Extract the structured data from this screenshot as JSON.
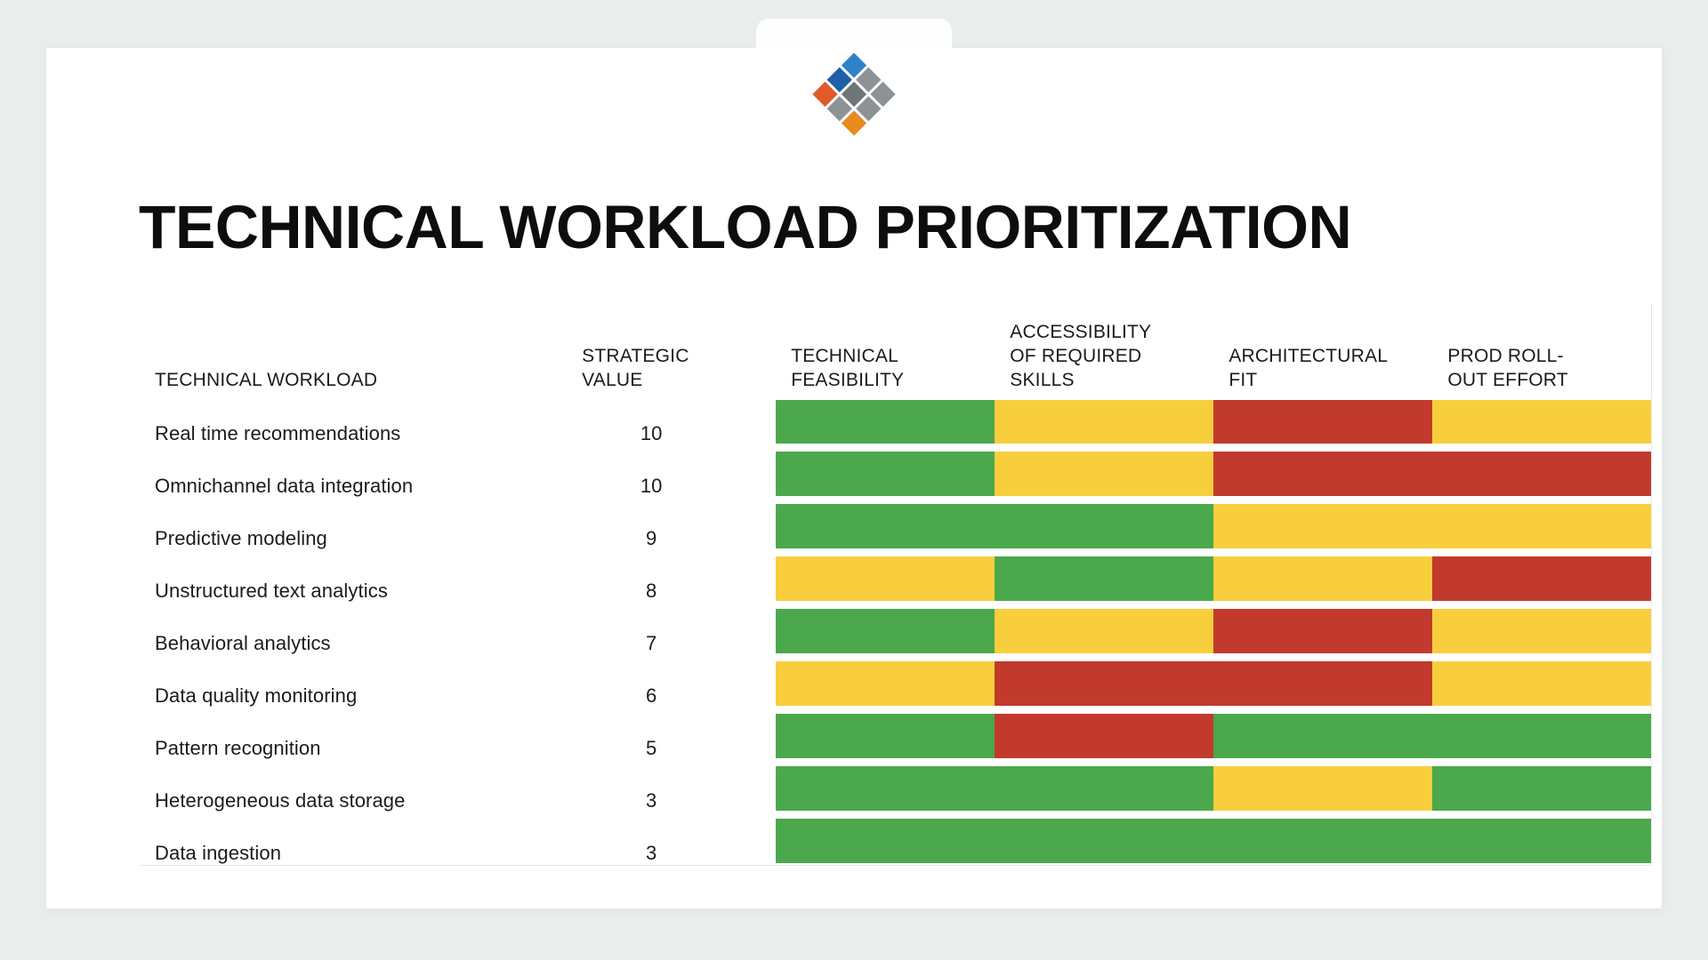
{
  "slide": {
    "title": "TECHNICAL WORKLOAD PRIORITIZATION",
    "background_color": "#e9edec",
    "card_color": "#ffffff"
  },
  "logo": {
    "name": "diamond-grid-logo",
    "tiles": [
      {
        "position": "top-left",
        "color": "#2e83c6"
      },
      {
        "position": "top-center",
        "color": "#8d9296"
      },
      {
        "position": "top-right",
        "color": "#8d9296"
      },
      {
        "position": "middle-left",
        "color": "#1f5fa9"
      },
      {
        "position": "middle-center",
        "color": "#6f7477"
      },
      {
        "position": "middle-right",
        "color": "#8d9296"
      },
      {
        "position": "bottom-left",
        "color": "#8d9296"
      },
      {
        "position": "bottom-center",
        "color": "#8d9296"
      },
      {
        "position": "bottom-right",
        "color": "#e98a1f"
      }
    ],
    "accent_bottom": "#e05a2b"
  },
  "legend_colors": {
    "green": "#4ba84c",
    "yellow": "#f8ce3d",
    "red": "#c13a2d"
  },
  "table": {
    "headers": {
      "workload": "TECHNICAL WORKLOAD",
      "strategic_value": "STRATEGIC\nVALUE",
      "spacer": "",
      "technical_feasibility": "TECHNICAL\nFEASIBILITY",
      "accessibility": "ACCESSIBILITY\nOF REQUIRED\nSKILLS",
      "architectural_fit": "ARCHITECTURAL\nFIT",
      "prod_rollout": "PROD ROLL-\nOUT EFFORT"
    },
    "header_list": [
      "TECHNICAL WORKLOAD",
      "STRATEGIC VALUE",
      "",
      "TECHNICAL FEASIBILITY",
      "ACCESSIBILITY OF REQUIRED SKILLS",
      "ARCHITECTURAL FIT",
      "PROD ROLL-OUT EFFORT"
    ],
    "rows": [
      {
        "workload": "Real time recommendations",
        "strategic_value": "10",
        "technical_feasibility": "green",
        "accessibility": "yellow",
        "architectural_fit": "red",
        "prod_rollout": "yellow"
      },
      {
        "workload": "Omnichannel data integration",
        "strategic_value": "10",
        "technical_feasibility": "green",
        "accessibility": "yellow",
        "architectural_fit": "red",
        "prod_rollout": "red"
      },
      {
        "workload": "Predictive modeling",
        "strategic_value": "9",
        "technical_feasibility": "green",
        "accessibility": "green",
        "architectural_fit": "yellow",
        "prod_rollout": "yellow"
      },
      {
        "workload": "Unstructured text analytics",
        "strategic_value": "8",
        "technical_feasibility": "yellow",
        "accessibility": "green",
        "architectural_fit": "yellow",
        "prod_rollout": "red"
      },
      {
        "workload": "Behavioral analytics",
        "strategic_value": "7",
        "technical_feasibility": "green",
        "accessibility": "yellow",
        "architectural_fit": "red",
        "prod_rollout": "yellow"
      },
      {
        "workload": "Data quality monitoring",
        "strategic_value": "6",
        "technical_feasibility": "yellow",
        "accessibility": "red",
        "architectural_fit": "red",
        "prod_rollout": "yellow"
      },
      {
        "workload": "Pattern recognition",
        "strategic_value": "5",
        "technical_feasibility": "green",
        "accessibility": "red",
        "architectural_fit": "green",
        "prod_rollout": "green"
      },
      {
        "workload": "Heterogeneous data storage",
        "strategic_value": "3",
        "technical_feasibility": "green",
        "accessibility": "green",
        "architectural_fit": "yellow",
        "prod_rollout": "green"
      },
      {
        "workload": "Data ingestion",
        "strategic_value": "3",
        "technical_feasibility": "green",
        "accessibility": "green",
        "architectural_fit": "green",
        "prod_rollout": "green"
      }
    ]
  }
}
